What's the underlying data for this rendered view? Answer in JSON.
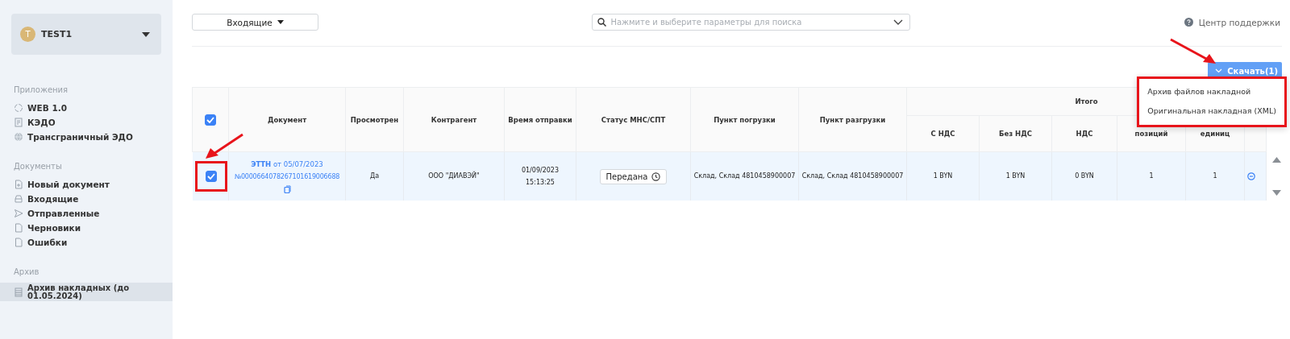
{
  "account": {
    "initial": "T",
    "name": "TEST1"
  },
  "sidebar": {
    "sections": [
      {
        "title": "Приложения",
        "items": [
          {
            "label": "WEB 1.0",
            "selected": false
          },
          {
            "label": "КЭДО",
            "selected": false
          },
          {
            "label": "Трансграничный ЭДО",
            "selected": false
          }
        ]
      },
      {
        "title": "Документы",
        "items": [
          {
            "label": "Новый документ",
            "selected": false
          },
          {
            "label": "Входящие",
            "selected": false
          },
          {
            "label": "Отправленные",
            "selected": false
          },
          {
            "label": "Черновики",
            "selected": false
          },
          {
            "label": "Ошибки",
            "selected": false
          }
        ]
      },
      {
        "title": "Архив",
        "items": [
          {
            "label": "Архив накладных (до 01.05.2024)",
            "selected": true
          }
        ]
      }
    ]
  },
  "toolbar": {
    "folder": "Входящие",
    "search": {
      "placeholder": "Нажмите и выберите параметры для поиска"
    },
    "help": "Центр поддержки"
  },
  "download": {
    "label": "Скачать(1)",
    "highlighted": true,
    "expanded": true,
    "menu": [
      "Архив файлов накладной",
      "Оригинальная накладная (XML)"
    ]
  },
  "table": {
    "select_all": {
      "checked": true
    },
    "columns": [
      "Документ",
      "Просмотрен",
      "Контрагент",
      "Время отправки",
      "Статус МНС/СПТ",
      "Пункт погрузки",
      "Пункт разгрузки"
    ],
    "group": {
      "label": "Итого",
      "columns": [
        "С НДС",
        "Без НДС",
        "НДС",
        "позиций",
        "единиц"
      ]
    },
    "rows": [
      {
        "checked": true,
        "highlighted": true,
        "document": "**ЭТТН** от 05/07/2023",
        "number": "№0000664078267101619006688",
        "viewed": "Да",
        "counterparty": "ООО \"ДИАВЭЙ\"",
        "sent_date": "01/09/2023",
        "sent_time": "15:13:25",
        "status": "Передана",
        "loading": "Склад, Склад 4810458900007",
        "unloading": "Склад, Склад 4810458900007",
        "with_vat": "1 BYN",
        "without_vat": "1 BYN",
        "vat": "0 BYN",
        "positions": "1",
        "units": "1"
      }
    ]
  }
}
